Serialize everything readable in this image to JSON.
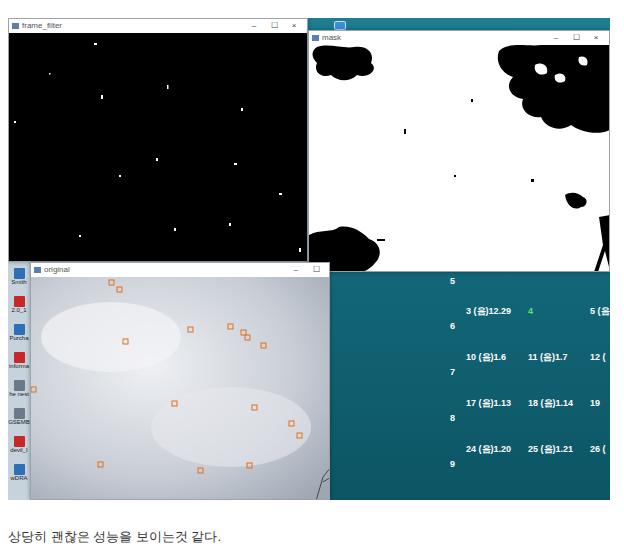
{
  "windows": [
    {
      "title": "frame_filter",
      "controls": [
        "–",
        "☐",
        "×"
      ]
    },
    {
      "title": "mask",
      "controls": [
        "–",
        "☐",
        "×"
      ]
    },
    {
      "title": "original",
      "controls": [
        "–",
        "☐"
      ]
    }
  ],
  "desktop_icons": [
    {
      "label": "Smith"
    },
    {
      "label": "2.0_1"
    },
    {
      "label": "Purcha"
    },
    {
      "label": "informa"
    },
    {
      "label": "he nest"
    },
    {
      "label": "GSEMB"
    },
    {
      "label": "devil_I"
    },
    {
      "label": "wDRA"
    }
  ],
  "calendar": {
    "weeks": [
      {
        "number": "5",
        "days": []
      },
      {
        "number": "6",
        "days": [
          {
            "label": "3 (음)12.29",
            "today": false
          },
          {
            "label": "4",
            "today": true
          },
          {
            "label": "5 (음",
            "today": false
          }
        ]
      },
      {
        "number": "7",
        "days": [
          {
            "label": "10 (음)1.6",
            "today": false
          },
          {
            "label": "11 (음)1.7",
            "today": false
          },
          {
            "label": "12 (",
            "today": false
          }
        ]
      },
      {
        "number": "8",
        "days": [
          {
            "label": "17 (음)1.13",
            "today": false
          },
          {
            "label": "18 (음)1.14",
            "today": false
          },
          {
            "label": "19",
            "today": false
          }
        ]
      },
      {
        "number": "9",
        "days": [
          {
            "label": "24 (음)1.20",
            "today": false
          },
          {
            "label": "25 (음)1.21",
            "today": false
          },
          {
            "label": "26 (",
            "today": false
          }
        ]
      }
    ]
  },
  "caption": "상당히 괜찮은 성능을 보이는것 같다."
}
